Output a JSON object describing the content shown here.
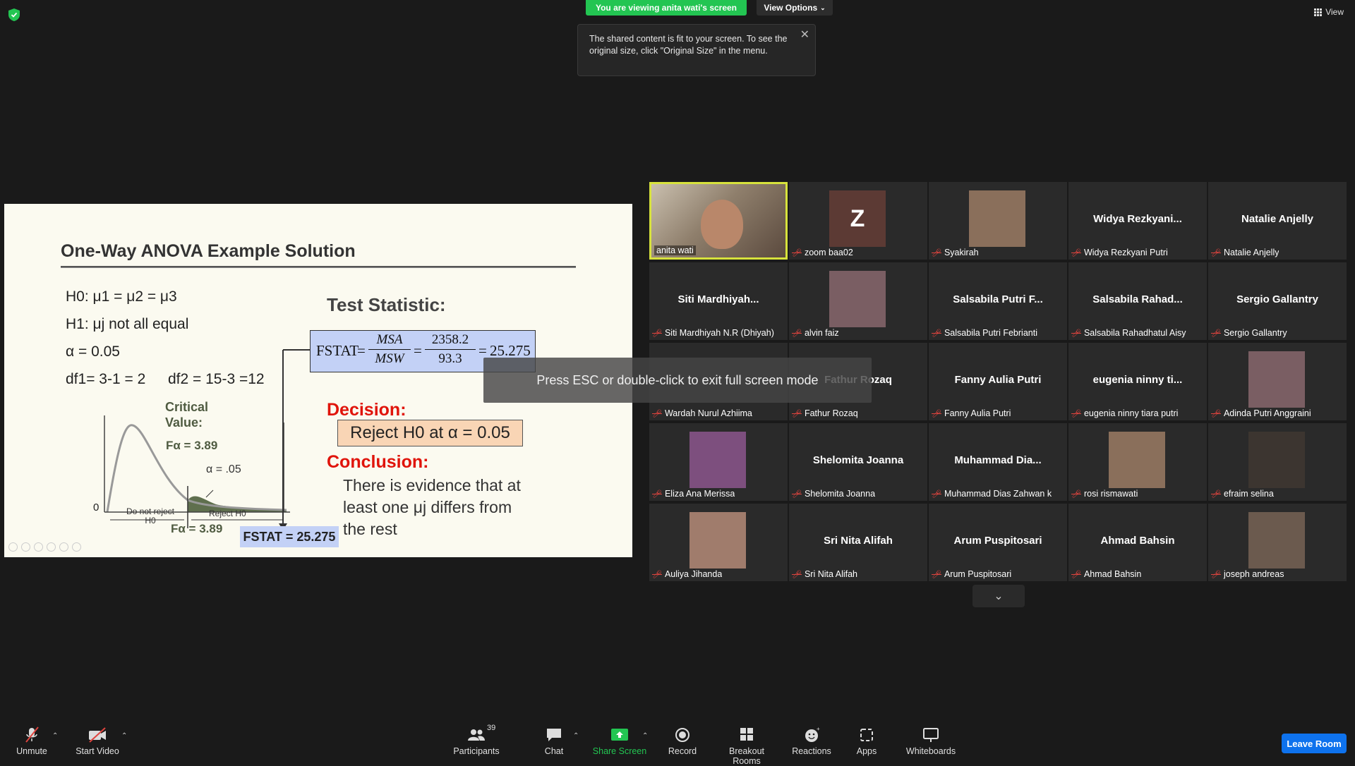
{
  "banner": {
    "viewing": "You are viewing anita wati's screen",
    "view_options": "View Options",
    "tooltip": "The shared content is fit to your screen. To see the original size, click \"Original Size\" in the menu.",
    "view": "View"
  },
  "slide": {
    "title": "One-Way ANOVA Example Solution",
    "h0": "H0: μ1 = μ2 = μ3",
    "h1": "H1: μj not all equal",
    "alpha": "α = 0.05",
    "df1": "df1= 3-1 = 2",
    "df2": "df2 = 15-3 =12",
    "critical_label": "Critical Value:",
    "f_alpha": "Fα = 3.89",
    "alpha_05": "α = .05",
    "zero": "0",
    "do_not_reject": "Do not reject H0",
    "reject_region": "Reject H0",
    "test_statistic": "Test Statistic:",
    "formula": {
      "lhs": "FSTAT",
      "num1": "MSA",
      "den1": "MSW",
      "num2": "2358.2",
      "den2": "93.3",
      "result": "25.275"
    },
    "decision": "Decision:",
    "reject_text": "Reject H0 at α = 0.05",
    "conclusion": "Conclusion:",
    "conclusion_text": "There is evidence that at least one μj differs from the rest",
    "fstat_value": "FSTAT = 25.275"
  },
  "esc_message": "Press ESC or double-click to exit full screen mode",
  "participants": [
    {
      "name": "anita wati",
      "display": "",
      "type": "video",
      "muted": false
    },
    {
      "name": "zoom baa02",
      "display": "Z",
      "type": "initial",
      "muted": true
    },
    {
      "name": "Syakirah",
      "display": "",
      "type": "photo",
      "muted": true
    },
    {
      "name": "Widya Rezkyani Putri",
      "display": "Widya  Rezkyani...",
      "type": "name",
      "muted": true
    },
    {
      "name": "Natalie Anjelly",
      "display": "Natalie Anjelly",
      "type": "name",
      "muted": true
    },
    {
      "name": "Siti Mardhiyah N.R (Dhiyah)",
      "display": "Siti  Mardhiyah...",
      "type": "name",
      "muted": true
    },
    {
      "name": "alvin faiz",
      "display": "",
      "type": "photo",
      "muted": true
    },
    {
      "name": "Salsabila Putri Febrianti",
      "display": "Salsabila  Putri  F...",
      "type": "name",
      "muted": true
    },
    {
      "name": "Salsabila Rahadhatul Aisy",
      "display": "Salsabila  Rahad...",
      "type": "name",
      "muted": true
    },
    {
      "name": "Sergio Gallantry",
      "display": "Sergio Gallantry",
      "type": "name",
      "muted": true
    },
    {
      "name": "Wardah Nurul Azhiima",
      "display": "",
      "type": "blank",
      "muted": true
    },
    {
      "name": "Fathur Rozaq",
      "display": "Fathur Rozaq",
      "type": "name",
      "muted": true
    },
    {
      "name": "Fanny Aulia Putri",
      "display": "Fanny Aulia Putri",
      "type": "name",
      "muted": true
    },
    {
      "name": "eugenia ninny tiara putri",
      "display": "eugenia  ninny  ti...",
      "type": "name",
      "muted": true
    },
    {
      "name": "Adinda Putri Anggraini",
      "display": "",
      "type": "photo",
      "muted": true
    },
    {
      "name": "Eliza Ana Merissa",
      "display": "",
      "type": "photo",
      "muted": true
    },
    {
      "name": "Shelomita Joanna",
      "display": "Shelomita Joanna",
      "type": "name",
      "muted": true
    },
    {
      "name": "Muhammad Dias Zahwan k",
      "display": "Muhammad  Dia...",
      "type": "name",
      "muted": true
    },
    {
      "name": "rosi rismawati",
      "display": "",
      "type": "photo",
      "muted": true
    },
    {
      "name": "efraim selina",
      "display": "",
      "type": "photo",
      "muted": true
    },
    {
      "name": "Auliya Jihanda",
      "display": "",
      "type": "photo",
      "muted": true
    },
    {
      "name": "Sri Nita Alifah",
      "display": "Sri Nita Alifah",
      "type": "name",
      "muted": true
    },
    {
      "name": "Arum Puspitosari",
      "display": "Arum Puspitosari",
      "type": "name",
      "muted": true
    },
    {
      "name": "Ahmad Bahsin",
      "display": "Ahmad Bahsin",
      "type": "name",
      "muted": true
    },
    {
      "name": "joseph andreas",
      "display": "",
      "type": "photo",
      "muted": true
    }
  ],
  "toolbar": {
    "unmute": "Unmute",
    "start_video": "Start Video",
    "participants": "Participants",
    "participants_count": "39",
    "chat": "Chat",
    "share_screen": "Share Screen",
    "record": "Record",
    "breakout_rooms": "Breakout Rooms",
    "reactions": "Reactions",
    "apps": "Apps",
    "whiteboards": "Whiteboards",
    "leave_room": "Leave Room"
  },
  "colors": {
    "share_green": "#23c552",
    "active_speaker": "#d7e23c",
    "leave_blue": "#0e72ed",
    "decision_red": "#e0140b"
  }
}
